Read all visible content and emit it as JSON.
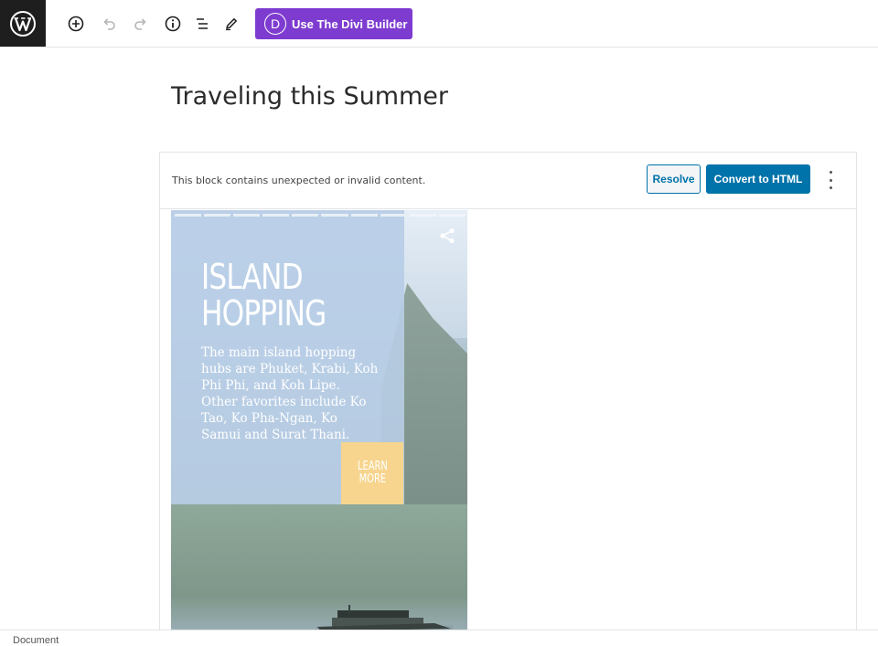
{
  "toolbar": {
    "divi_button_letter": "D",
    "divi_button_label": "Use The Divi Builder",
    "accent_color": "#7e3bd0"
  },
  "post": {
    "title": "Traveling this Summer"
  },
  "block_warning": {
    "message": "This block contains unexpected or invalid content.",
    "resolve_label": "Resolve",
    "convert_label": "Convert to HTML",
    "primary_color": "#0073aa"
  },
  "story": {
    "heading_line1": "ISLAND",
    "heading_line2": "HOPPING",
    "body": "The main island hopping hubs are Phuket, Krabi, Koh Phi Phi, and Koh Lipe. Other favorites include Ko Tao, Ko Pha-Ngan, Ko Samui and Surat Thani.",
    "cta_line1": "LEARN",
    "cta_line2": "MORE",
    "cta_color": "#f7d58e",
    "progress_total_segments": 10,
    "progress_active_segments": 8
  },
  "footer": {
    "breadcrumb": "Document"
  }
}
